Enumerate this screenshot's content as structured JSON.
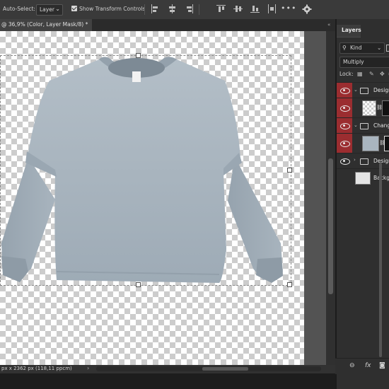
{
  "options_bar": {
    "auto_select_label": "Auto-Select:",
    "auto_select_value": "Layer",
    "show_transform_label": "Show Transform Controls",
    "more_label": "•••"
  },
  "document": {
    "tab_title": "@ 36,9% (Color, Layer Mask/8) *",
    "status_text": "px x 2362 px (118,11 ppcm)"
  },
  "layers_panel": {
    "tab_label": "Layers",
    "kind_label": "Kind",
    "blend_mode": "Multiply",
    "lock_label": "Lock:",
    "layers": [
      {
        "name": "Design I",
        "type": "group",
        "visible": true,
        "highlighted": true
      },
      {
        "name": "",
        "type": "smart-object",
        "visible": true,
        "highlighted": true
      },
      {
        "name": "Change",
        "type": "group",
        "visible": true,
        "highlighted": true
      },
      {
        "name": "",
        "type": "layer-with-mask",
        "visible": true,
        "highlighted": true
      },
      {
        "name": "Design",
        "type": "group",
        "visible": true,
        "highlighted": false
      },
      {
        "name": "Backgr",
        "type": "layer",
        "visible": false,
        "highlighted": false
      }
    ],
    "bottom_icons": [
      "link-icon",
      "fx-icon",
      "mask-icon"
    ]
  },
  "colors": {
    "accent_eye": "#9b2d30",
    "sweater": "#a9b5bf",
    "panel_bg": "#2f2f2f"
  }
}
